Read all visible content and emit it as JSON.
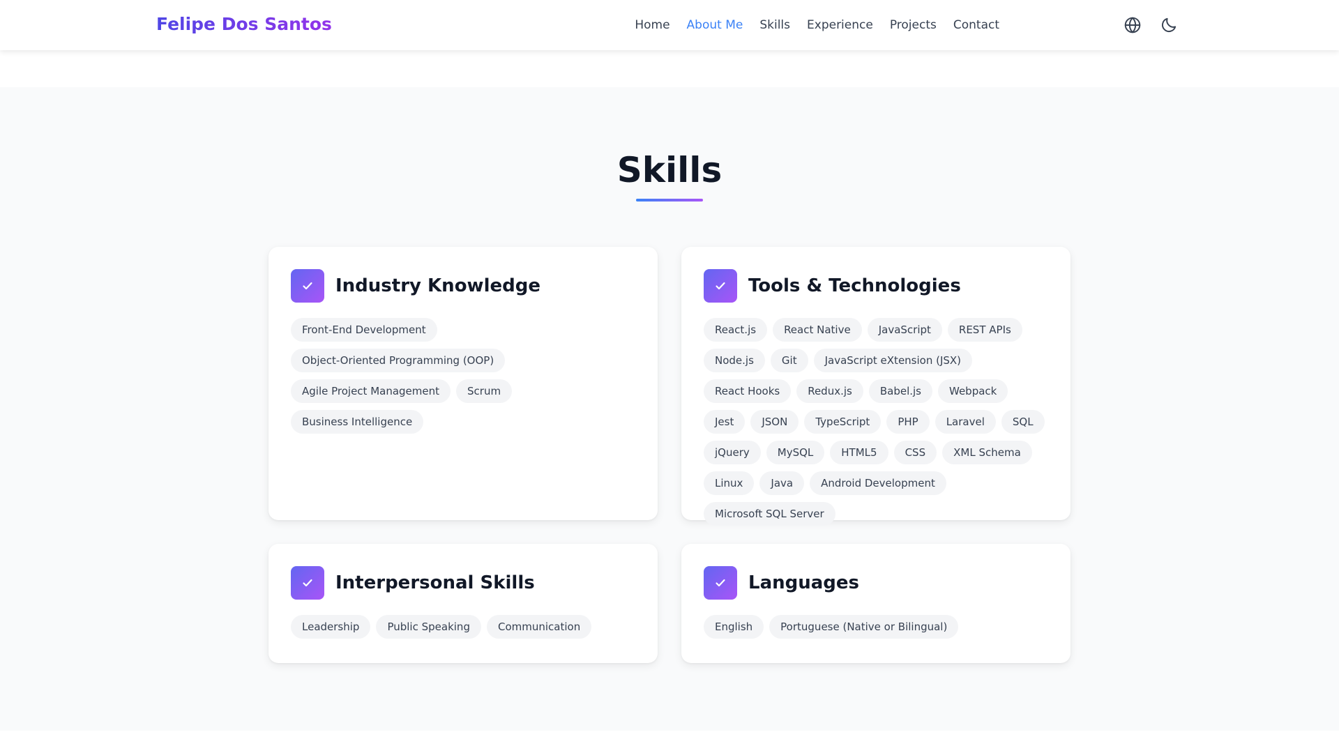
{
  "navbar": {
    "brand": "Felipe Dos Santos",
    "links": [
      "Home",
      "About Me",
      "Skills",
      "Experience",
      "Projects",
      "Contact"
    ],
    "active_link": "About Me",
    "icons": [
      "globe-icon",
      "moon-icon"
    ]
  },
  "skills": {
    "title": "Skills",
    "cards": [
      {
        "title": "Industry Knowledge",
        "tags": [
          "Front-End Development",
          "Object-Oriented Programming (OOP)",
          "Agile Project Management",
          "Scrum",
          "Business Intelligence"
        ]
      },
      {
        "title": "Tools & Technologies",
        "tags": [
          "React.js",
          "React Native",
          "JavaScript",
          "REST APIs",
          "Node.js",
          "Git",
          "JavaScript eXtension (JSX)",
          "React Hooks",
          "Redux.js",
          "Babel.js",
          "Webpack",
          "Jest",
          "JSON",
          "TypeScript",
          "PHP",
          "Laravel",
          "SQL",
          "jQuery",
          "MySQL",
          "HTML5",
          "CSS",
          "XML Schema",
          "Linux",
          "Java",
          "Android Development",
          "Microsoft SQL Server"
        ]
      },
      {
        "title": "Interpersonal Skills",
        "tags": [
          "Leadership",
          "Public Speaking",
          "Communication"
        ]
      },
      {
        "title": "Languages",
        "tags": [
          "English",
          "Portuguese (Native or Bilingual)"
        ]
      }
    ]
  },
  "colors": {
    "brand_gradient_start": "#4f46e5",
    "brand_gradient_end": "#9333ea",
    "active_link": "#3b82f6",
    "section_background": "#f9fafb",
    "tag_background": "#f3f4f6"
  }
}
